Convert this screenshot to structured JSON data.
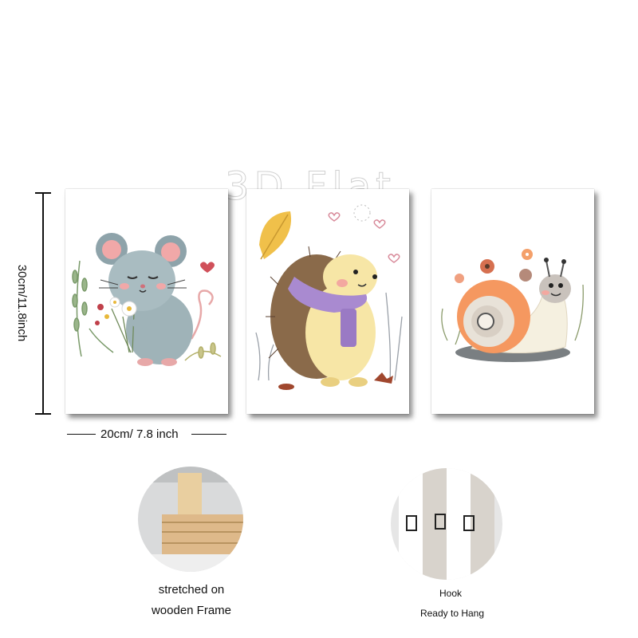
{
  "watermark": "3D Flat",
  "dimensions": {
    "height": "30cm/11.8inch",
    "width": "20cm/ 7.8 inch"
  },
  "panels": [
    {
      "subject": "mouse-holding-flowers"
    },
    {
      "subject": "hedgehog-with-scarf"
    },
    {
      "subject": "snail-with-flowers"
    }
  ],
  "features": {
    "frame_caption_line1": "stretched on",
    "frame_caption_line2": "wooden Frame",
    "hook_caption_line1": "Hook",
    "hook_caption_line2": "Ready to Hang"
  }
}
